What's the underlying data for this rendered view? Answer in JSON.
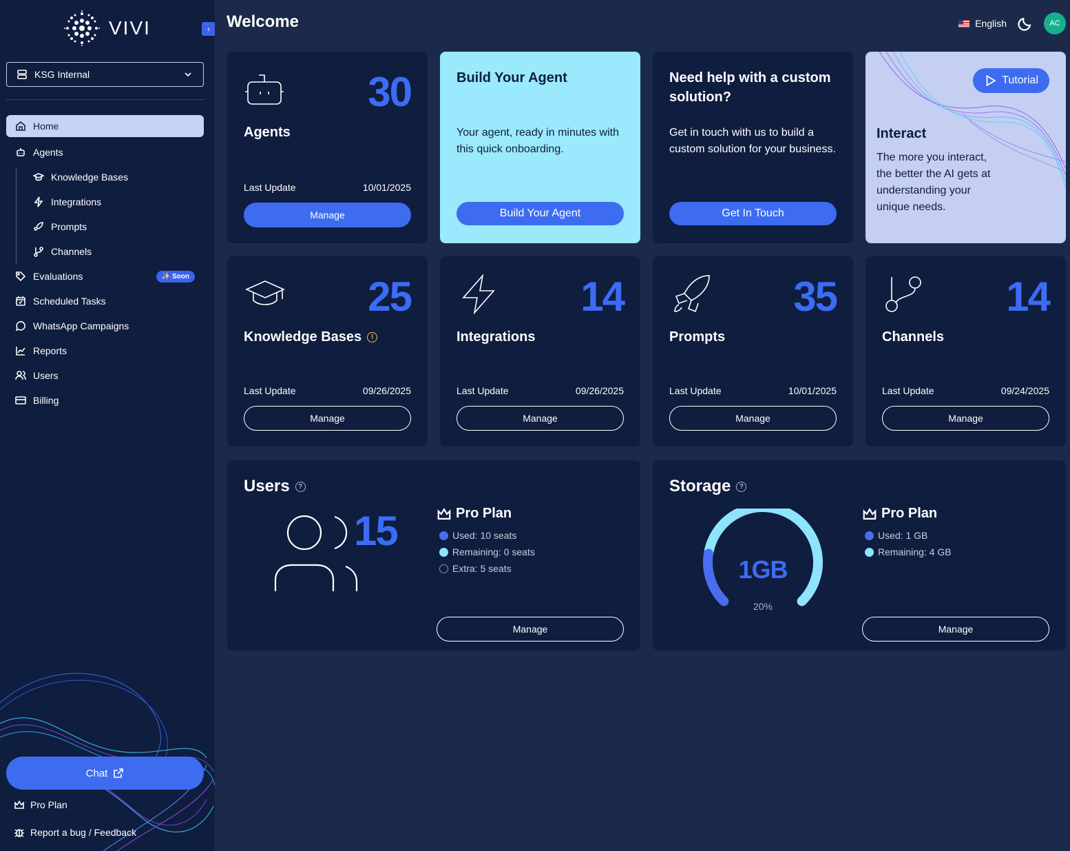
{
  "sidebar": {
    "logo_text": "VIVI",
    "org": "KSG Internal",
    "nav": {
      "home": "Home",
      "agents": "Agents",
      "knowledge_bases": "Knowledge Bases",
      "integrations": "Integrations",
      "prompts": "Prompts",
      "channels": "Channels",
      "evaluations": "Evaluations",
      "soon_badge": "✨ Soon",
      "scheduled_tasks": "Scheduled Tasks",
      "whatsapp": "WhatsApp Campaigns",
      "reports": "Reports",
      "users": "Users",
      "billing": "Billing"
    },
    "chat_label": "Chat",
    "plan_label": "Pro Plan",
    "report_label": "Report a bug / Feedback"
  },
  "header": {
    "title": "Welcome",
    "language": "English",
    "avatar_initials": "AC"
  },
  "cards": {
    "agents": {
      "count": "30",
      "title": "Agents",
      "last_update_label": "Last Update",
      "last_update": "10/01/2025",
      "button": "Manage"
    },
    "build": {
      "title": "Build Your Agent",
      "text": "Your agent, ready in minutes with this quick onboarding.",
      "button": "Build Your Agent"
    },
    "custom": {
      "title": "Need help with a custom solution?",
      "text": "Get in touch with us to build a custom solution for your business.",
      "button": "Get In Touch"
    },
    "interact": {
      "tutorial": "Tutorial",
      "title": "Interact",
      "text": "The more you interact, the better the AI gets at understanding your unique needs."
    },
    "knowledge": {
      "count": "25",
      "title": "Knowledge Bases",
      "last_update_label": "Last Update",
      "last_update": "09/26/2025",
      "button": "Manage"
    },
    "integrations": {
      "count": "14",
      "title": "Integrations",
      "last_update_label": "Last Update",
      "last_update": "09/26/2025",
      "button": "Manage"
    },
    "prompts": {
      "count": "35",
      "title": "Prompts",
      "last_update_label": "Last Update",
      "last_update": "10/01/2025",
      "button": "Manage"
    },
    "channels": {
      "count": "14",
      "title": "Channels",
      "last_update_label": "Last Update",
      "last_update": "09/24/2025",
      "button": "Manage"
    },
    "users": {
      "title": "Users",
      "count": "15",
      "plan": "Pro Plan",
      "used": "Used: 10 seats",
      "remaining": "Remaining: 0 seats",
      "extra": "Extra: 5 seats",
      "button": "Manage"
    },
    "storage": {
      "title": "Storage",
      "value": "1GB",
      "percent_label": "20%",
      "percent": 0.2,
      "plan": "Pro Plan",
      "used": "Used: 1 GB",
      "remaining": "Remaining: 4 GB",
      "button": "Manage"
    }
  },
  "colors": {
    "accent": "#3d6cf0",
    "number_blue": "#3c6cf5",
    "cyan": "#8fe3ff",
    "card_bg": "#0f1d3e",
    "page_bg": "#1b2a4a",
    "avatar_bg": "#17b08b"
  }
}
